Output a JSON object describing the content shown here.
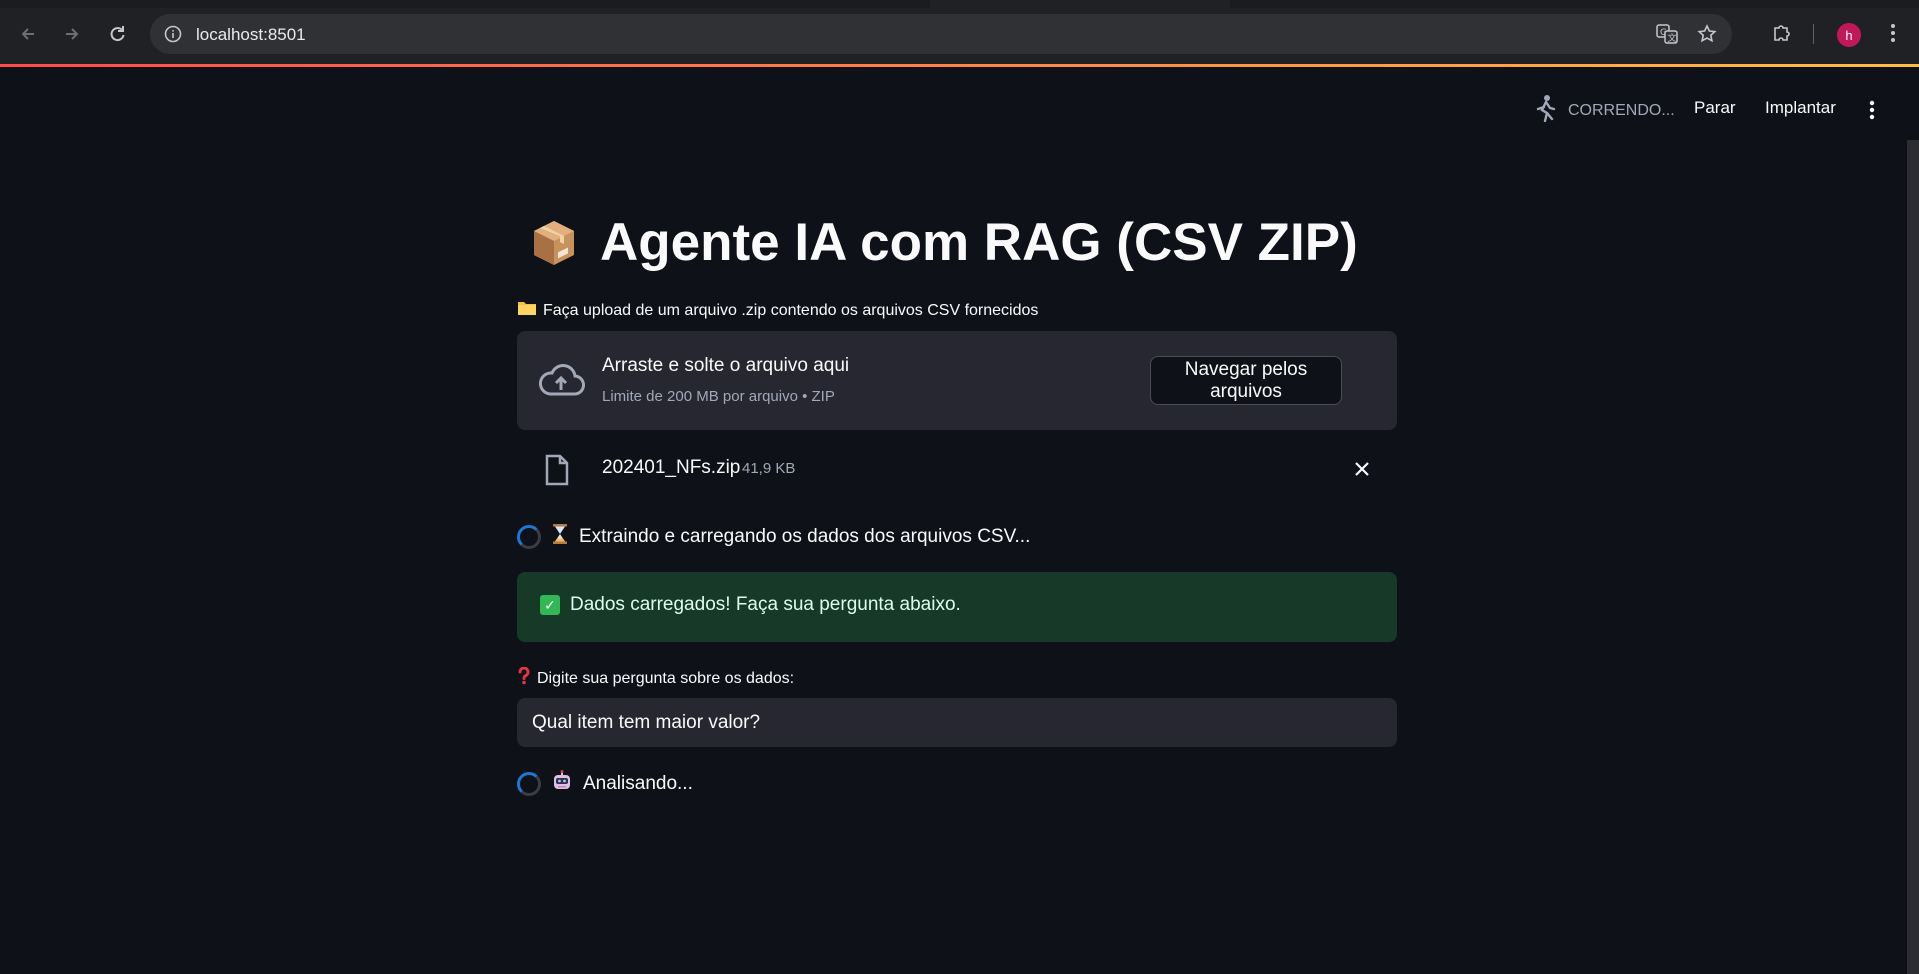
{
  "browser": {
    "url": "localhost:8501",
    "profile_initial": "h",
    "icons": {
      "back": "arrow-left-icon",
      "forward": "arrow-right-icon",
      "reload": "reload-icon",
      "site_info": "info-circle-icon",
      "translate": "translate-icon",
      "bookmark": "star-icon",
      "extensions": "puzzle-icon"
    }
  },
  "header": {
    "status": "CORRENDO...",
    "stop_label": "Parar",
    "deploy_label": "Implantar"
  },
  "main": {
    "title": "Agente IA com RAG (CSV ZIP)",
    "upload_label": "Faça upload de um arquivo .zip contendo os arquivos CSV fornecidos",
    "dropzone": {
      "title": "Arraste e solte o arquivo aqui",
      "subtitle": "Limite de 200 MB por arquivo • ZIP",
      "browse_label": "Navegar pelos arquivos"
    },
    "file": {
      "name": "202401_NFs.zip",
      "size": "41,9 KB"
    },
    "loading_text": "Extraindo e carregando os dados dos arquivos CSV...",
    "success_text": "Dados carregados! Faça sua pergunta abaixo.",
    "question_label": "Digite sua pergunta sobre os dados:",
    "question_value": "Qual item tem maior valor?",
    "analyzing_text": "Analisando..."
  },
  "colors": {
    "background": "#0e1117",
    "surface": "#262730",
    "success_bg": "#173928",
    "accent": "#ff4b4b",
    "spinner": "#1f77d4"
  }
}
